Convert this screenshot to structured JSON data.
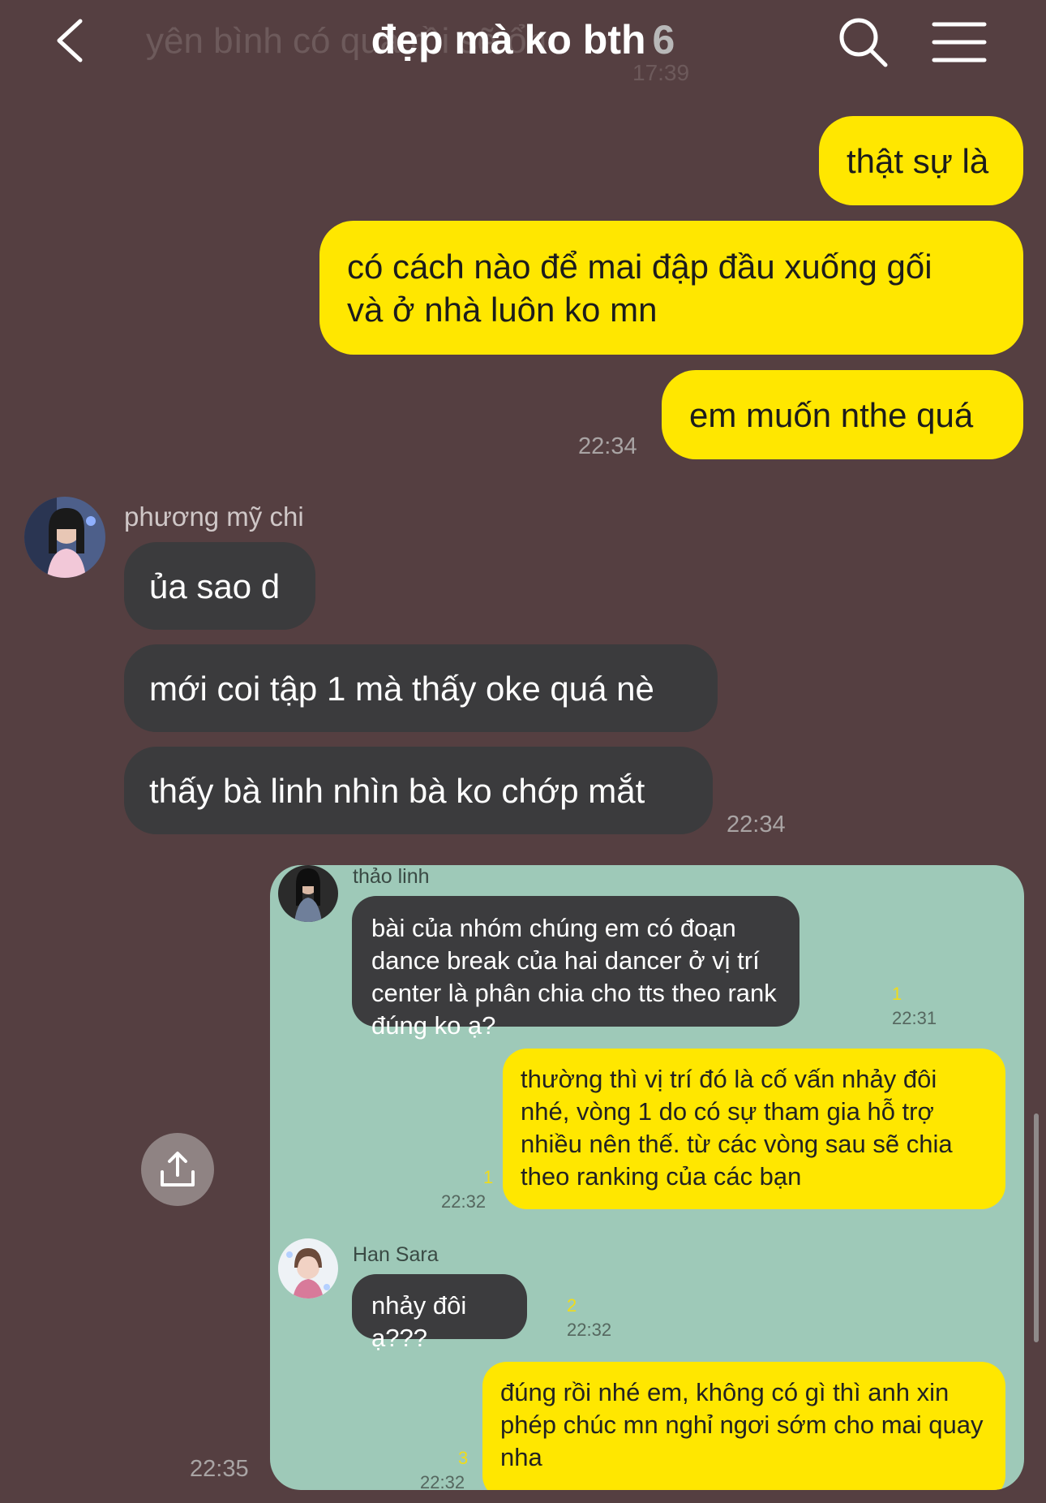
{
  "header": {
    "back_icon": "chevron-left-icon",
    "ghost_text": "yên bình có qua rồi sẽ ổn",
    "ghost_time": "17:39",
    "title": "đẹp mà ko bth",
    "member_count": "6",
    "search_icon": "search-icon",
    "menu_icon": "hamburger-menu-icon"
  },
  "messages": {
    "m1": "thật sự là",
    "m2_line1": "có cách nào để mai đập đầu xuống gối",
    "m2_line2": "và ở nhà luôn ko mn",
    "m3": "em muốn nthe quá",
    "m3_time": "22:34",
    "sender_name": "phương mỹ chi",
    "t1": "ủa sao d",
    "t2": "mới coi tập 1 mà thấy oke quá nè",
    "t3": "thấy bà linh nhìn bà ko chớp mắt",
    "t3_time": "22:34",
    "card_time": "22:35"
  },
  "card": {
    "c1_name": "thảo linh",
    "c1_text": "bài của nhóm chúng em có đoạn dance break của hai dancer ở vị trí center là phân chia cho tts theo rank đúng ko ạ?",
    "c1_unread": "1",
    "c1_time": "22:31",
    "c2_text": "thường thì vị trí đó là cố vấn nhảy đôi nhé, vòng 1 do có sự tham gia hỗ trợ nhiều nên thế. từ các vòng sau sẽ chia theo ranking của các bạn",
    "c2_unread": "1",
    "c2_time": "22:32",
    "c3_name": "Han Sara",
    "c3_text": "nhảy đôi ạ???",
    "c3_unread": "2",
    "c3_time": "22:32",
    "c4_text": "đúng rồi nhé em, không có gì thì anh xin phép chúc mn nghỉ ngơi sớm cho mai quay nha",
    "c4_unread": "3",
    "c4_time": "22:32"
  },
  "share_icon": "share-upload-icon",
  "colors": {
    "background": "#553f41",
    "my_bubble": "#ffe700",
    "their_bubble": "#3b3b3d",
    "card_bg": "#9ec9b8"
  }
}
